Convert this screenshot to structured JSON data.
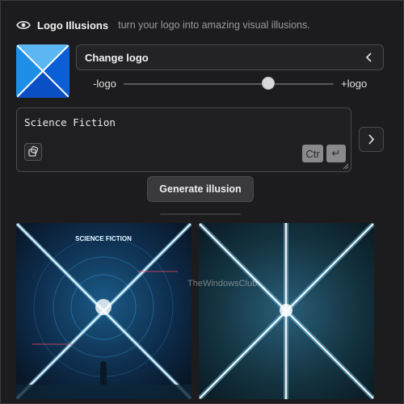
{
  "header": {
    "title": "Logo Illusions",
    "subtitle": "turn your logo into amazing visual illusions.",
    "icon": "eye-icon"
  },
  "logo_picker": {
    "change_label": "Change logo",
    "chevron_icon": "chevron-left-icon",
    "thumbnail_colors": {
      "left": "#1e8fe6",
      "top": "#5cb6f2",
      "right": "#0b5fd6",
      "bottom": "#0a4fc4",
      "lines": "#ffffff"
    }
  },
  "slider": {
    "min_label": "-logo",
    "max_label": "+logo",
    "value_fraction": 0.69
  },
  "prompt": {
    "value": "Science Fiction",
    "shortcut_ctrl": "Ctr",
    "shortcut_enter": "↵",
    "dice_icon": "dice-icon"
  },
  "next_button": {
    "icon": "chevron-right-icon"
  },
  "generate": {
    "label": "Generate illusion"
  },
  "results": {
    "image1_caption": "SCIENCE FICTION",
    "watermark": "TheWindowsClub"
  },
  "colors": {
    "background": "#1c1c1e",
    "border": "#4a4a4e",
    "button": "#3a3a3d"
  }
}
